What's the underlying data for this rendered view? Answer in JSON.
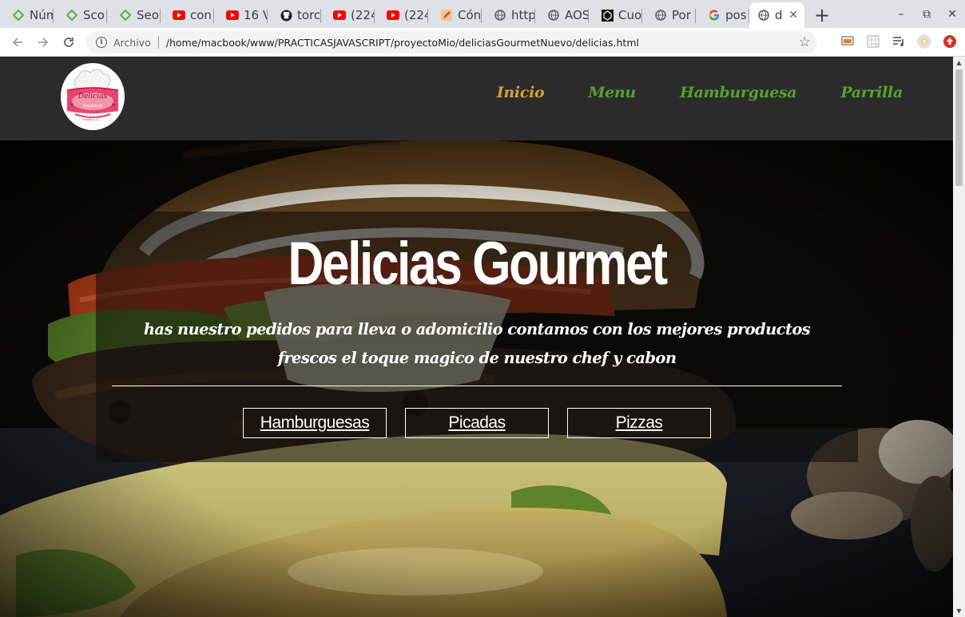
{
  "browser": {
    "tabs": [
      {
        "title": "Núm",
        "icon": "diamond-icon",
        "color": "#5fb548"
      },
      {
        "title": "Sco",
        "icon": "diamond-icon",
        "color": "#5fb548"
      },
      {
        "title": "Seo",
        "icon": "diamond-icon",
        "color": "#5fb548"
      },
      {
        "title": "con",
        "icon": "youtube-icon",
        "color": "#ff0000"
      },
      {
        "title": "16 V",
        "icon": "youtube-icon",
        "color": "#ff0000"
      },
      {
        "title": "torc",
        "icon": "github-icon",
        "color": "#202124"
      },
      {
        "title": "(224",
        "icon": "youtube-icon",
        "color": "#ff0000"
      },
      {
        "title": "(224",
        "icon": "youtube-icon",
        "color": "#ff0000"
      },
      {
        "title": "Cón",
        "icon": "pencil-icon",
        "color": "#c0652b"
      },
      {
        "title": "http",
        "icon": "globe-icon",
        "color": "#5f6368"
      },
      {
        "title": "AOS",
        "icon": "globe-icon",
        "color": "#5f6368"
      },
      {
        "title": "Cuo",
        "icon": "codepen-icon",
        "color": "#111111"
      },
      {
        "title": "Por",
        "icon": "globe-icon",
        "color": "#5f6368"
      },
      {
        "title": "pos",
        "icon": "google-icon",
        "color": "#4285f4"
      }
    ],
    "active_tab": {
      "title": "d",
      "icon": "globe-icon",
      "close": "✕"
    },
    "new_tab": "+",
    "window_controls": {
      "minimize": "–",
      "restore": "⧉",
      "close": "✕"
    },
    "address": {
      "scheme_label": "Archivo",
      "url": "/home/macbook/www/PRACTICASJAVASCRIPT/proyectoMio/deliciasGourmetNuevo/delicias.html"
    }
  },
  "page": {
    "colors": {
      "nav_bg": "#2b2b2b",
      "nav_link": "#56a12e",
      "nav_link_active": "#d6a22c"
    },
    "logo": {
      "top_text": "Delicias",
      "mid_text": "Gourmet",
      "bottom_text": "Pedidos al ..."
    },
    "menu": [
      {
        "label": "Inicio",
        "active": true
      },
      {
        "label": "Menu",
        "active": false
      },
      {
        "label": "Hamburguesa",
        "active": false
      },
      {
        "label": "Parrilla",
        "active": false
      }
    ],
    "hero": {
      "title": "Delicias Gourmet",
      "subtitle": "has nuestro pedidos para lleva o adomicilio contamos con los mejores productos frescos el toque magico de nuestro chef y cabon",
      "buttons": [
        "Hamburguesas",
        "Picadas",
        "Pizzas"
      ]
    }
  }
}
